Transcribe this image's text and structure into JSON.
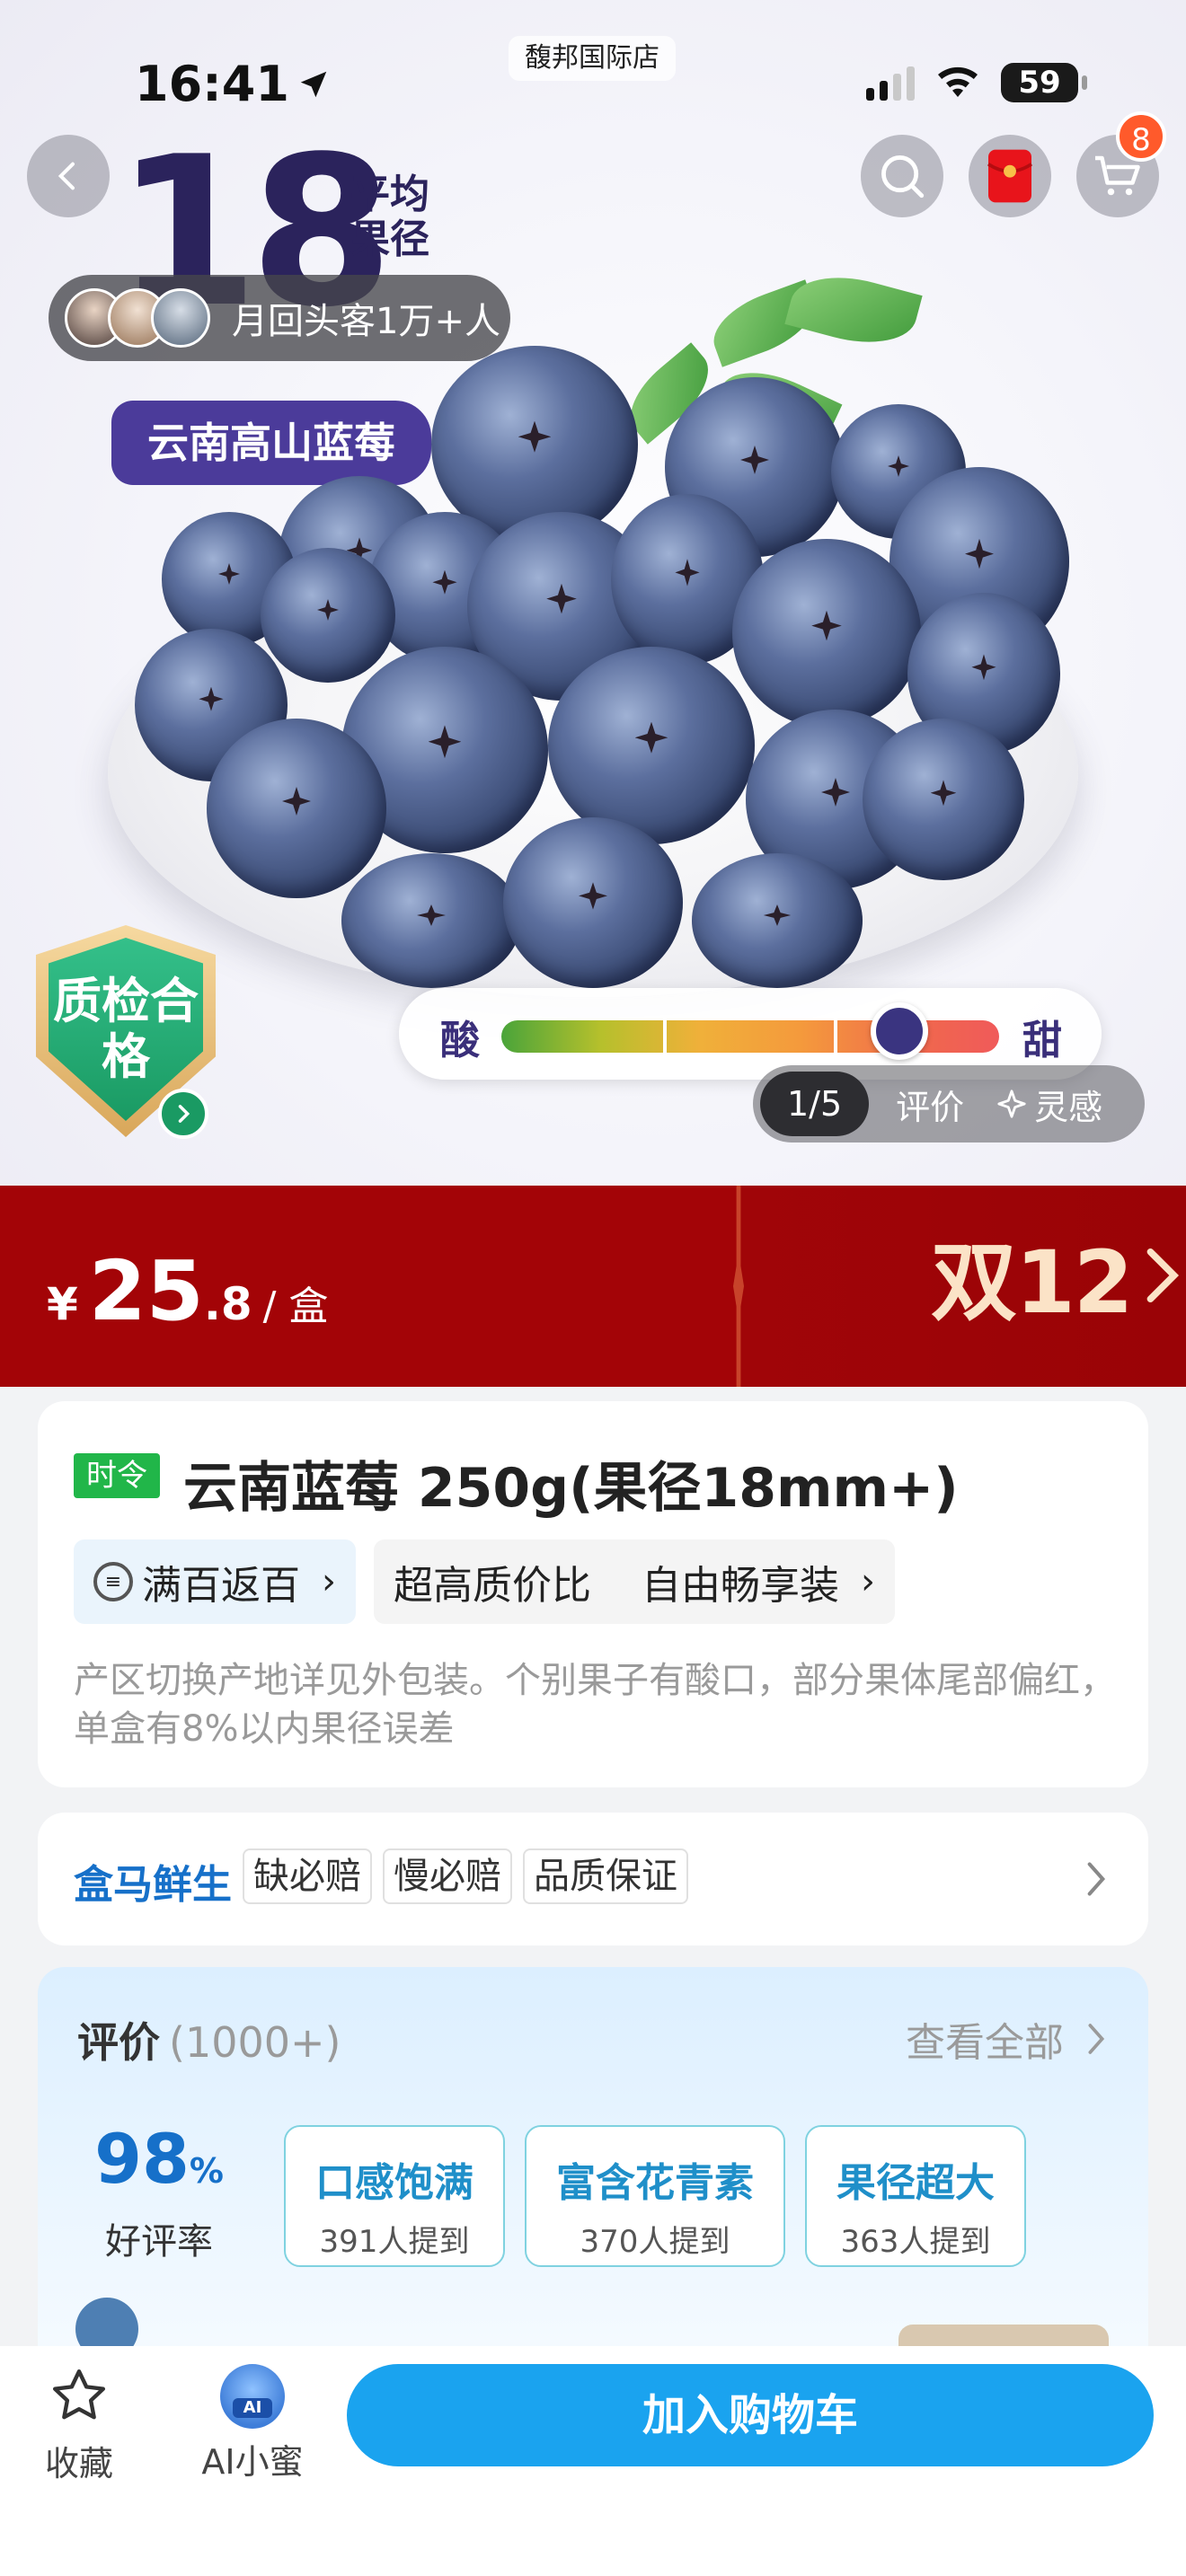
{
  "status_bar": {
    "time": "16:41",
    "store": "馥邦国际店",
    "battery": "59"
  },
  "header": {
    "cart_badge": "8"
  },
  "hero": {
    "size_number": "18",
    "size_label": "平均果径",
    "repeat_customers": "月回头客1万+人",
    "origin_tag": "云南高山蓝莓",
    "quality_badge": "质检合格",
    "taste_left": "酸",
    "taste_right": "甜",
    "sweetness_level": 0.8,
    "media_counter": "1/5",
    "media_review": "评价",
    "media_inspire": "灵感"
  },
  "price": {
    "currency": "¥",
    "integer": "25",
    "decimal": ".8",
    "unit": "/ 盒"
  },
  "promo": {
    "title": "双12",
    "subtitle": ""
  },
  "product": {
    "season_tag": "时令",
    "name": "云南蓝莓 250g(果径18mm+)",
    "coupon_chip": "满百返百",
    "feature_chip_1": "超高质价比",
    "feature_chip_2": "自由畅享装",
    "note": "产区切换产地详见外包装。个别果子有酸口，部分果体尾部偏红，单盒有8%以内果径误差"
  },
  "service": {
    "brand": "盒马鲜生",
    "tags": [
      "缺必赔",
      "慢必赔",
      "品质保证"
    ]
  },
  "reviews": {
    "title": "评价",
    "count": "(1000+)",
    "view_all": "查看全部",
    "rate_number": "98",
    "rate_unit": "%",
    "rate_label": "好评率",
    "keywords": [
      {
        "keyword": "口感饱满",
        "mentions": "391人提到"
      },
      {
        "keyword": "富含花青素",
        "mentions": "370人提到"
      },
      {
        "keyword": "果径超大",
        "mentions": "363人提到"
      }
    ]
  },
  "bottom_bar": {
    "favorite": "收藏",
    "ai_assistant": "AI小蜜",
    "ai_badge": "AI",
    "add_to_cart": "加入购物车"
  },
  "colors": {
    "price_banner": "#a30407",
    "cart_button": "#1aa3ef",
    "brand_blue": "#1670c9",
    "season_green": "#21b649"
  }
}
